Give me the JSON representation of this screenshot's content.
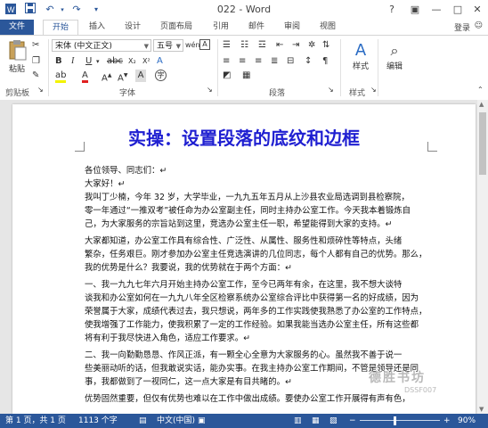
{
  "window": {
    "title": "022 - Word"
  },
  "quick_access": {
    "save_icon": "save-icon",
    "undo_icon": "undo-icon",
    "redo_icon": "redo-icon"
  },
  "window_controls": {
    "help": "?",
    "ribbon_opts": "▣",
    "minimize": "—",
    "restore": "□",
    "close": "✕"
  },
  "tabs": [
    "文件",
    "开始",
    "插入",
    "设计",
    "页面布局",
    "引用",
    "邮件",
    "审阅",
    "视图"
  ],
  "account": {
    "login": "登录"
  },
  "ribbon": {
    "clipboard": {
      "paste": "粘贴",
      "label": "剪贴板"
    },
    "font": {
      "name": "宋体 (中文正文)",
      "size": "五号",
      "label": "字体"
    },
    "paragraph": {
      "label": "段落"
    },
    "styles": {
      "label": "样式",
      "button": "样式"
    },
    "editing": {
      "button": "编辑"
    }
  },
  "document": {
    "heading": "实操：设置段落的底纹和边框",
    "lines": [
      "各位领导、同志们：↵",
      "    大家好！↵",
      "    我叫丁少楠，今年 32 岁，大学毕业，一九九五年五月从上沙县农业局选调到县检察院，",
      "零一年通过“一推双考”被任命为办公室副主任，同时主持办公室工作。今天我本着锻炼自",
      "己，为大家服务的宗旨站到这里，竞选办公室主任一职，希望能得到大家的支持。↵",
      "    大家都知道，办公室工作具有综合性、广泛性、从属性、服务性和烦碎性等特点，头绪",
      "繁杂，任务艰巨。刚才参加办公室主任竞选演讲的几位同志，每个人都有自己的优势。那么，",
      "我的优势是什么？我要说，我的优势就在于两个方面：↵",
      "    一、我一九九七年六月开始主持办公室工作，至今已两年有余，在这里，我不想大谈特",
      "谈我和办公室如何在一九九八年全区检察系统办公室综合评比中获得第一名的好成绩，因为",
      "荣誉属于大家，成绩代表过去，我只想说，两年多的工作实践使我熟悉了办公室的工作特点，",
      "使我增强了工作能力，使我积累了一定的工作经验。如果我能当选办公室主任，所有这些都",
      "将有利于我尽快进入角色，适应工作要求。↵",
      "    二、我一向勤勤恳恳、作风正派，有一颗全心全意为大家服务的心。虽然我不善于说一",
      "些美丽动听的话，但我敢说实话，能办实事。在我主持办公室工作期间，不管是领导还是同",
      "事，我都做到了一视同仁，这一点大家是有目共睹的。↵",
      "    优势固然重要，但仅有优势也难以在工作中做出成绩。要使办公室工作开展得有声有色，"
    ]
  },
  "statusbar": {
    "page": "第 1 页，共 1 页",
    "words": "1113 个字",
    "lang": "中文(中国)",
    "zoom": "90%"
  },
  "watermark": {
    "text": "德胜书坊",
    "sub": "DSSF007"
  }
}
